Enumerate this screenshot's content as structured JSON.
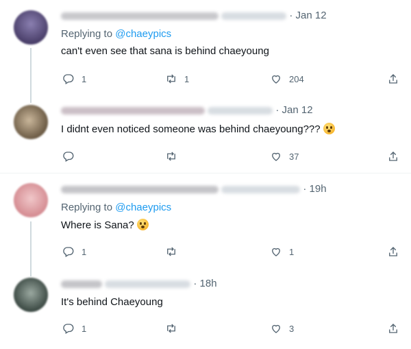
{
  "tweets": [
    {
      "time": "Jan 12",
      "replying_label": "Replying to",
      "replying_to": "@chaeypics",
      "text": "can't even see that sana is behind chaeyoung",
      "replies": "1",
      "retweets": "1",
      "likes": "204"
    },
    {
      "time": "Jan 12",
      "text": "I didnt even noticed someone was behind chaeyoung???",
      "replies": "",
      "retweets": "",
      "likes": "37"
    },
    {
      "time": "19h",
      "replying_label": "Replying to",
      "replying_to": "@chaeypics",
      "text": "Where is Sana?",
      "replies": "1",
      "retweets": "",
      "likes": "1"
    },
    {
      "time": "18h",
      "text": "It's behind Chaeyoung",
      "replies": "1",
      "retweets": "",
      "likes": "3"
    }
  ],
  "colors": {
    "accent": "#1d9bf0",
    "secondary_text": "#536471",
    "primary_text": "#0f1419",
    "thread_line": "#cfd9de"
  },
  "icons": [
    "reply-icon",
    "retweet-icon",
    "like-icon",
    "share-icon"
  ]
}
